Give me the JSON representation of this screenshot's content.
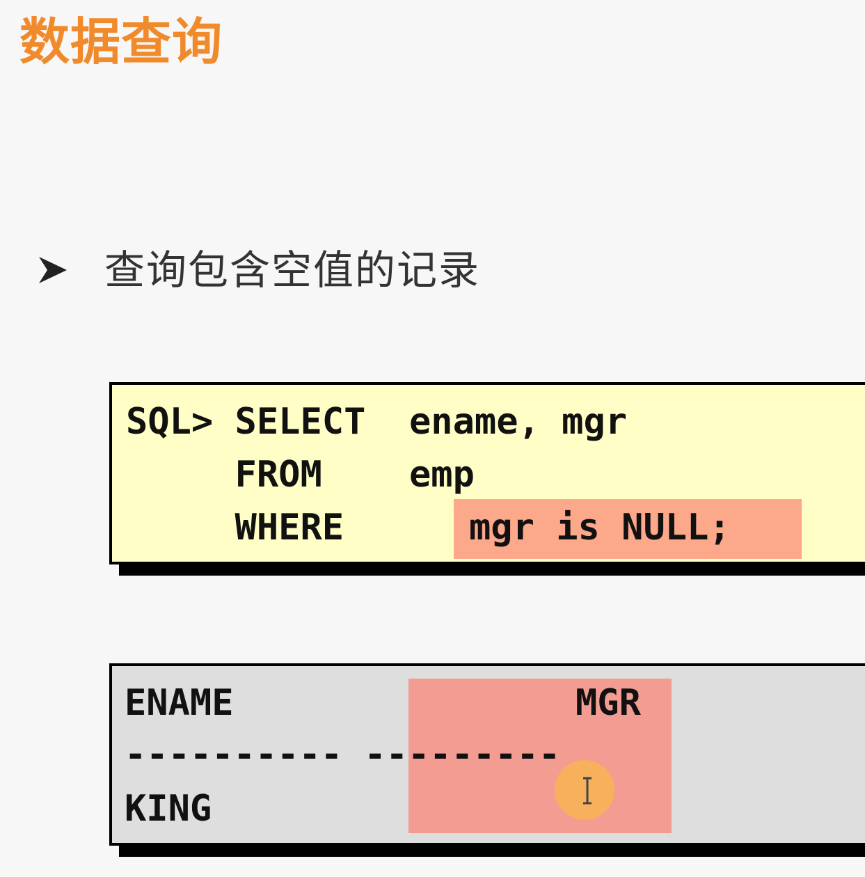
{
  "slide": {
    "title": "数据查询",
    "bullet": "查询包含空值的记录"
  },
  "sql_box": {
    "lines": [
      "SQL> SELECT  ename, mgr",
      "     FROM    emp",
      "     WHERE   "
    ],
    "condition": "mgr is NULL;"
  },
  "result_box": {
    "header_left": "ENAME",
    "header_right": "MGR",
    "divider": "---------- ---------",
    "row_value": "KING"
  },
  "colors": {
    "title": "#f08a2a",
    "sql_bg": "#fefec6",
    "result_bg": "#dedede",
    "condition_highlight": "#fca88a",
    "column_highlight": "#f39c92",
    "cursor_highlight": "#f7b258"
  },
  "icons": {
    "bullet": "arrowhead-bullet-icon",
    "cursor": "text-cursor-icon"
  }
}
